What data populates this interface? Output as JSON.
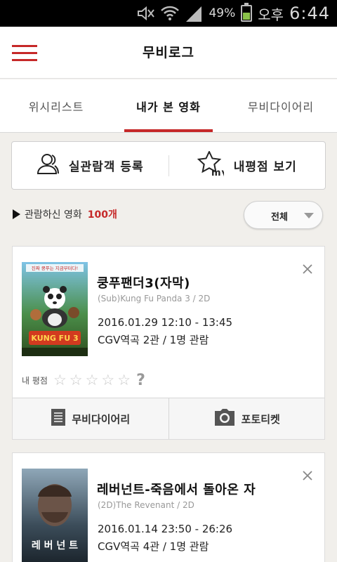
{
  "status_bar": {
    "battery": "49%",
    "ampm": "오후",
    "time": "6:44"
  },
  "header": {
    "title": "무비로그"
  },
  "tabs": [
    {
      "label": "위시리스트",
      "active": false
    },
    {
      "label": "내가 본 영화",
      "active": true
    },
    {
      "label": "무비다이어리",
      "active": false
    }
  ],
  "actions": {
    "register_label": "실관람객 등록",
    "my_reviews_label": "내평점 보기",
    "my_badge": "my"
  },
  "summary": {
    "label": "관람하신 영화",
    "count": "100개"
  },
  "filter": {
    "selected": "전체"
  },
  "movies": [
    {
      "title": "쿵푸팬더3(자막)",
      "subtitle": "(Sub)Kung Fu Panda 3 / 2D",
      "datetime": "2016.01.29 12:10 - 13:45",
      "place": "CGV역곡 2관 / 1명 관람",
      "rating_label": "내 평점",
      "rating_unknown": "?",
      "poster_text": "진짜 쿵푸는 지금부터다!",
      "diary_label": "무비다이어리",
      "photo_ticket_label": "포토티켓"
    },
    {
      "title": "레버넌트-죽음에서 돌아온 자",
      "subtitle": "(2D)The Revenant / 2D",
      "datetime": "2016.01.14 23:50 - 26:26",
      "place": "CGV역곡 4관 / 1명 관람",
      "poster_text": "레 버 넌 트"
    }
  ],
  "colors": {
    "accent": "#c62828",
    "background": "#f1efeb"
  }
}
